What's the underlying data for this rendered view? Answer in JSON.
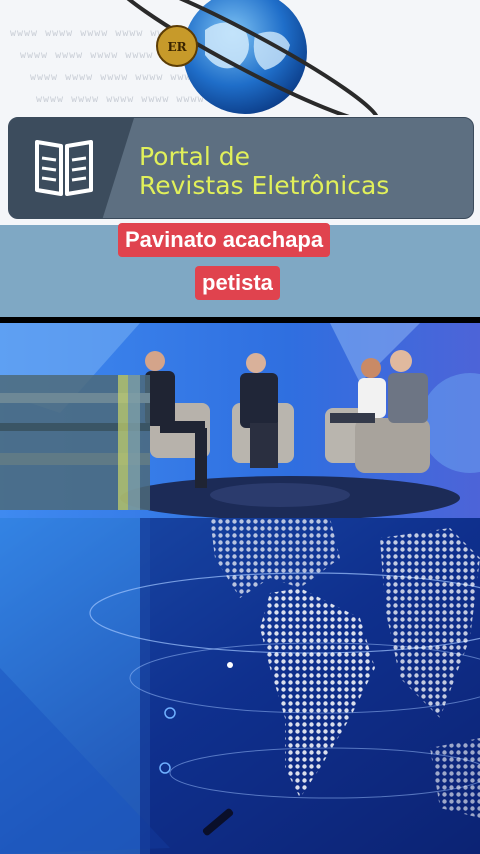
{
  "banner": {
    "line1": "Portal de",
    "line2": "Revistas Eletrônicas"
  },
  "headline": {
    "line1": "Pavinato acachapa",
    "line2": "petista"
  },
  "colors": {
    "banner_text": "#e1f05a",
    "caption_bg": "#e0434e",
    "studio_bg": "#3f7fe0"
  },
  "icons": [
    "globe-logo",
    "open-book-icon"
  ]
}
